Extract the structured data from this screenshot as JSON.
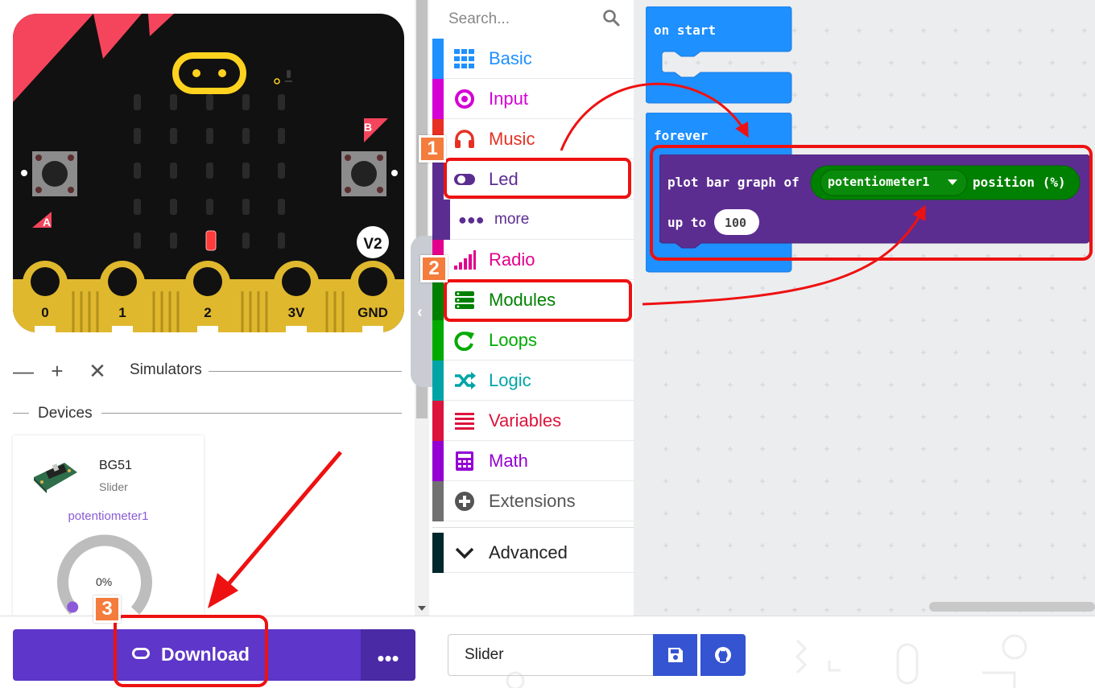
{
  "simulator": {
    "pin_labels": [
      "0",
      "1",
      "2",
      "3V",
      "GND"
    ],
    "button_a": "A",
    "button_b": "B",
    "version_badge": "V2",
    "controls_title": "Simulators",
    "devices_label": "Devices",
    "device": {
      "name": "BG51",
      "type": "Slider",
      "pin": "potentiometer1",
      "value": "0%",
      "dial_fraction": 0
    }
  },
  "toolbox": {
    "search_placeholder": "Search...",
    "categories": [
      {
        "label": "Basic",
        "color": "#1e90ff",
        "icon": "grid-icon"
      },
      {
        "label": "Input",
        "color": "#d400d4",
        "icon": "target-icon"
      },
      {
        "label": "Music",
        "color": "#e63022",
        "icon": "headphones-icon"
      },
      {
        "label": "Led",
        "color": "#5c2d91",
        "icon": "toggle-icon"
      },
      {
        "label": "more",
        "color": "#5c2d91",
        "icon": "dots-icon"
      },
      {
        "label": "Radio",
        "color": "#e3008c",
        "icon": "signal-icon"
      },
      {
        "label": "Modules",
        "color": "#008000",
        "icon": "modules-icon"
      },
      {
        "label": "Loops",
        "color": "#00aa00",
        "icon": "loop-icon"
      },
      {
        "label": "Logic",
        "color": "#00a4a6",
        "icon": "shuffle-icon"
      },
      {
        "label": "Variables",
        "color": "#dc143c",
        "icon": "list-icon"
      },
      {
        "label": "Math",
        "color": "#9400d3",
        "icon": "calculator-icon"
      },
      {
        "label": "Extensions",
        "color": "#717171",
        "icon": "plus-circle-icon"
      },
      {
        "label": "Advanced",
        "color": "#00272b",
        "icon": "chevron-down-icon"
      }
    ]
  },
  "workspace": {
    "on_start": "on start",
    "forever": "forever",
    "plot_block": {
      "prefix": "plot bar graph of",
      "dropdown": "potentiometer1",
      "suffix": "position (%)",
      "up_to": "up to",
      "value": "100"
    }
  },
  "bottom": {
    "download": "Download",
    "more": "•••",
    "project_name": "Slider"
  },
  "annotations": {
    "step1": "1",
    "step2": "2",
    "step3": "3"
  },
  "colors": {
    "brand_purple": "#5e36c9",
    "annotation_red": "#ee1111",
    "badge_orange": "#f47c3c",
    "block_blue": "#1e90ff",
    "led_purple": "#5c2d91",
    "modules_green": "#008000"
  }
}
